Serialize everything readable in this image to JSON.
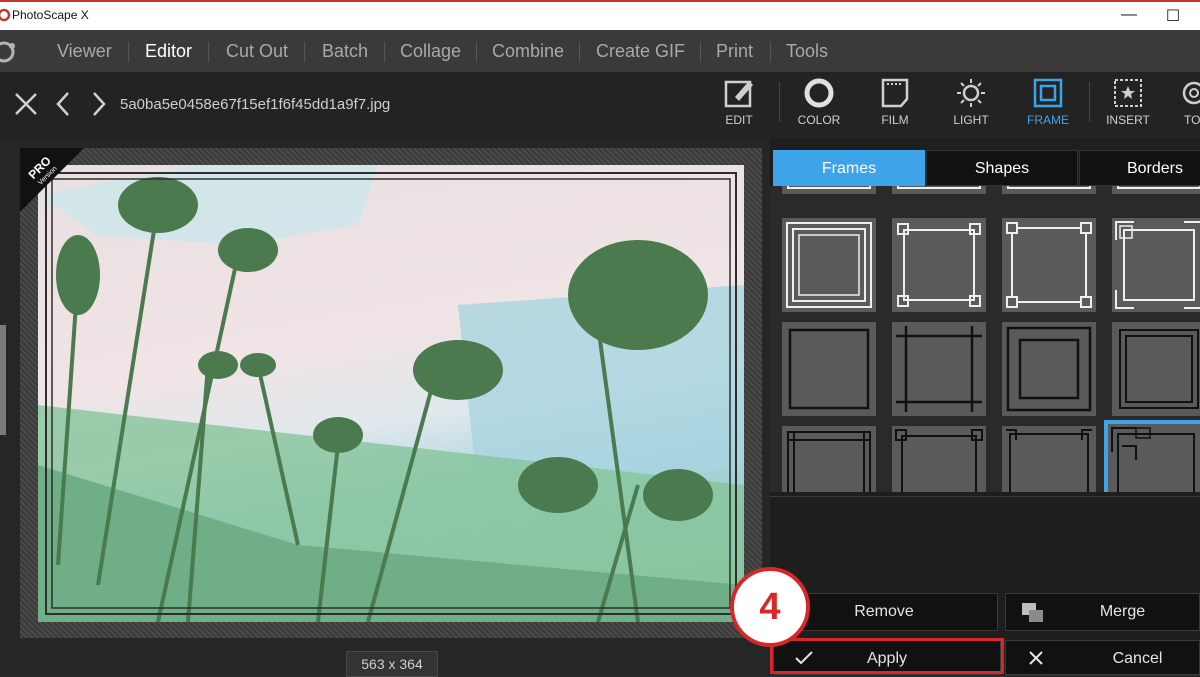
{
  "window": {
    "title": "PhotoScape X",
    "min_glyph": "—",
    "max_glyph": "☐"
  },
  "menu": {
    "items": [
      {
        "label": "Viewer",
        "active": false
      },
      {
        "label": "Editor",
        "active": true
      },
      {
        "label": "Cut Out",
        "active": false
      },
      {
        "label": "Batch",
        "active": false
      },
      {
        "label": "Collage",
        "active": false
      },
      {
        "label": "Combine",
        "active": false
      },
      {
        "label": "Create GIF",
        "active": false
      },
      {
        "label": "Print",
        "active": false
      },
      {
        "label": "Tools",
        "active": false
      }
    ]
  },
  "toolbar": {
    "filename": "5a0ba5e0458e67f15ef1f6f45dd1a9f7.jpg",
    "tools": [
      {
        "label": "EDIT",
        "icon": "edit-icon"
      },
      {
        "label": "COLOR",
        "icon": "color-icon"
      },
      {
        "label": "FILM",
        "icon": "film-icon"
      },
      {
        "label": "LIGHT",
        "icon": "light-icon"
      },
      {
        "label": "FRAME",
        "icon": "frame-icon",
        "active": true
      },
      {
        "label": "INSERT",
        "icon": "insert-icon"
      },
      {
        "label": "TO",
        "icon": "tools-icon"
      }
    ]
  },
  "canvas": {
    "pro_badge_line1": "PRO",
    "pro_badge_line2": "Version",
    "image_size": "563 x 364"
  },
  "panel": {
    "tabs": [
      {
        "label": "Frames",
        "active": true
      },
      {
        "label": "Shapes",
        "active": false
      },
      {
        "label": "Borders",
        "active": false
      }
    ],
    "remove_label": "Remove",
    "merge_label": "Merge",
    "apply_label": "Apply",
    "cancel_label": "Cancel"
  },
  "annotation": {
    "step_number": "4"
  },
  "colors": {
    "accent": "#3ea3e8",
    "highlight": "#d62828",
    "panel_bg": "#1e1e1e"
  }
}
